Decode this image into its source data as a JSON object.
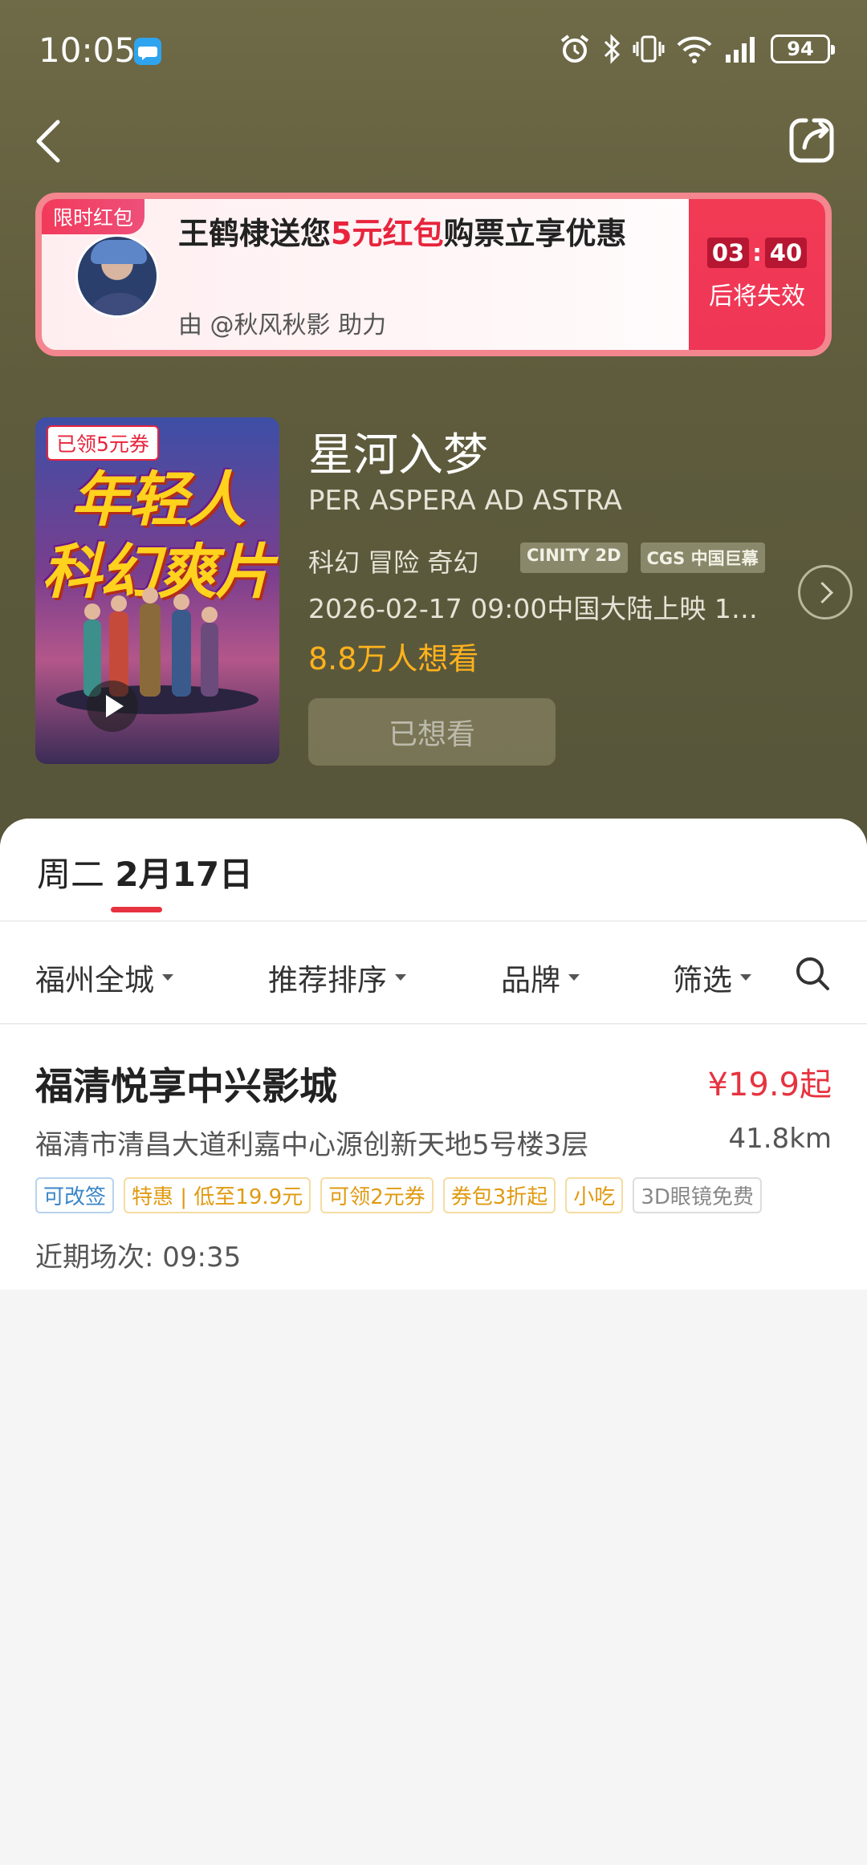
{
  "status_bar": {
    "time": "10:05",
    "battery": "94"
  },
  "coupon": {
    "tag": "限时红包",
    "text_before": "王鹤棣送您",
    "text_highlight": "5元红包",
    "text_after": "购票立享优惠",
    "sub": "由 @秋风秋影 助力",
    "countdown_min": "03",
    "countdown_sec": "40",
    "countdown_label": "后将失效"
  },
  "movie": {
    "poster_tag": "已领5元券",
    "poster_title_line1": "年轻人",
    "poster_title_line2": "科幻爽片",
    "title": "星河入梦",
    "title_en": "PER ASPERA AD ASTRA",
    "genre": "科幻 冒险 奇幻",
    "formats": [
      "CINITY 2D",
      "CGS 中国巨幕"
    ],
    "release": "2026-02-17 09:00中国大陆上映 11…",
    "want_count": "8.8万人想看",
    "want_button": "已想看"
  },
  "date_tab": {
    "weekday": "周二",
    "date": "2月17日"
  },
  "filters": {
    "city": "福州全城",
    "sort": "推荐排序",
    "brand": "品牌",
    "filter": "筛选"
  },
  "cinema": {
    "name": "福清悦享中兴影城",
    "price": "¥19.9起",
    "address": "福清市清昌大道利嘉中心源创新天地5号楼3层",
    "distance": "41.8km",
    "tags": [
      "可改签",
      "特惠 | 低至19.9元",
      "可领2元券",
      "券包3折起",
      "小吃",
      "3D眼镜免费"
    ],
    "showtimes": "近期场次: 09:35"
  },
  "colors": {
    "accent": "#e6333f",
    "want": "#ffb21c",
    "hero_bg": "#6f6a47"
  }
}
